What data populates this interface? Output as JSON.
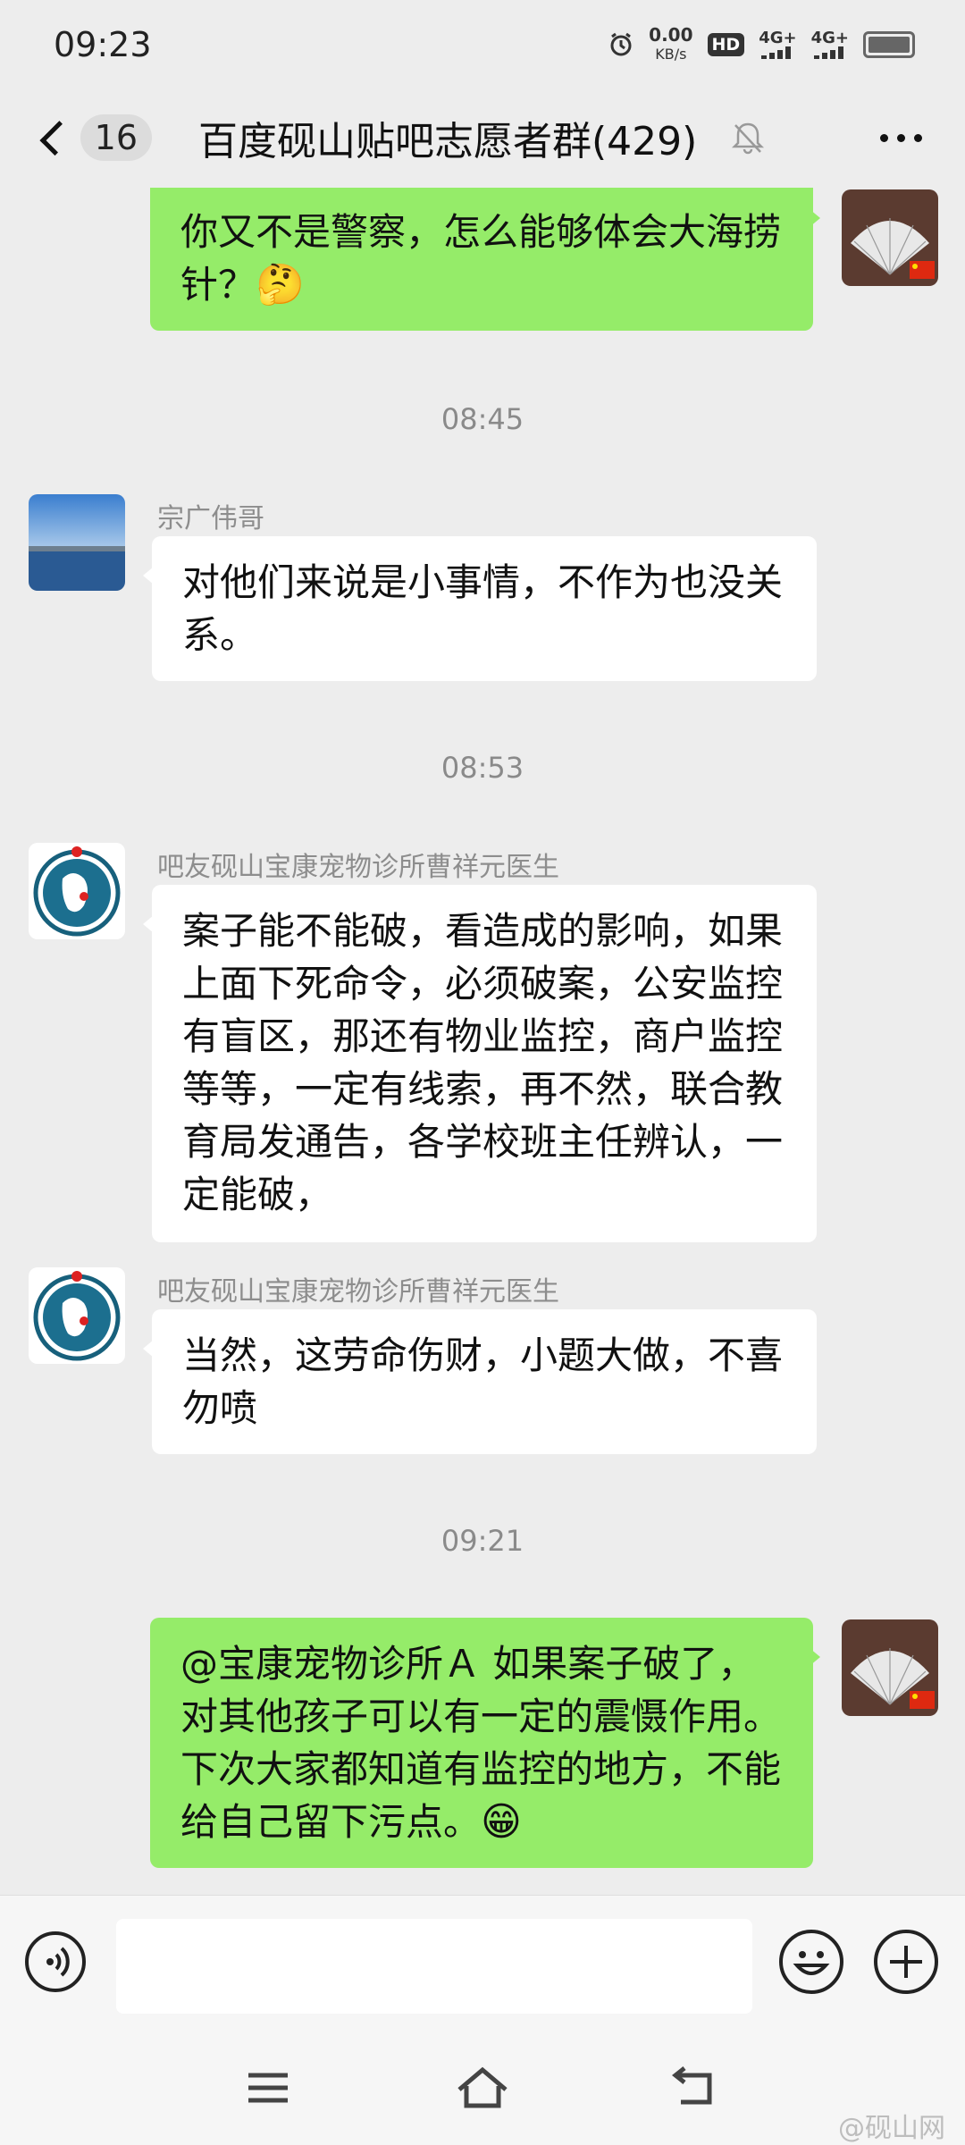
{
  "status_bar": {
    "time": "09:23",
    "net_speed_value": "0.00",
    "net_speed_unit": "KB/s",
    "hd": "HD",
    "signal_1": "4G+",
    "signal_2": "4G+"
  },
  "header": {
    "back_count": "16",
    "title": "百度砚山贴吧志愿者群(429)",
    "mute_icon": "bell-off-icon",
    "more_icon": "more-dots-icon"
  },
  "messages": [
    {
      "type": "outgoing",
      "text": "你又不是警察，怎么能够体会大海捞针？",
      "emoji": "🤔"
    },
    {
      "type": "time",
      "text": "08:45"
    },
    {
      "type": "incoming",
      "sender": "宗广伟哥",
      "text": "对他们来说是小事情，不作为也没关系。"
    },
    {
      "type": "time",
      "text": "08:53"
    },
    {
      "type": "incoming",
      "sender": "吧友砚山宝康宠物诊所曹祥元医生",
      "text": "案子能不能破，看造成的影响，如果上面下死命令，必须破案，公安监控有盲区，那还有物业监控，商户监控等等，一定有线索，再不然，联合教育局发通告，各学校班主任辨认，一定能破，"
    },
    {
      "type": "incoming",
      "sender": "吧友砚山宝康宠物诊所曹祥元医生",
      "text": "当然，这劳命伤财，小题大做，不喜勿喷"
    },
    {
      "type": "time",
      "text": "09:21"
    },
    {
      "type": "outgoing",
      "text": "@宝康宠物诊所Ａ 如果案子破了，对其他孩子可以有一定的震慑作用。下次大家都知道有监控的地方，不能给自己留下污点。",
      "emoji": "😁"
    }
  ],
  "input_bar": {
    "voice_icon": "voice-icon",
    "emoji_icon": "smiley-icon",
    "plus_icon": "plus-circle-icon",
    "input_value": ""
  },
  "nav_bar": {
    "menu_icon": "menu-icon",
    "home_icon": "home-icon",
    "back_icon": "back-icon",
    "watermark": "@砚山网"
  },
  "colors": {
    "background": "#ededed",
    "outgoing_bubble": "#95ec69",
    "incoming_bubble": "#ffffff",
    "timestamp_text": "#8a8a8a"
  }
}
